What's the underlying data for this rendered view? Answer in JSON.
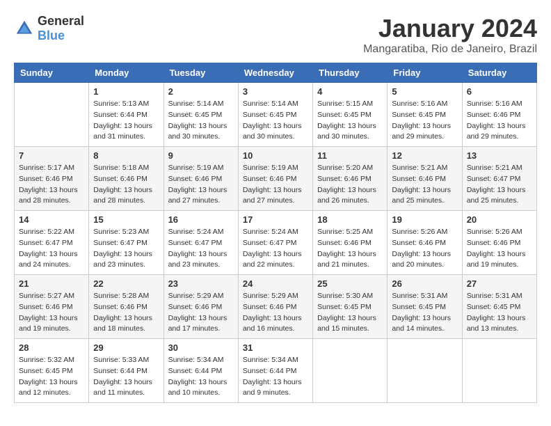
{
  "header": {
    "logo_general": "General",
    "logo_blue": "Blue",
    "month_title": "January 2024",
    "location": "Mangaratiba, Rio de Janeiro, Brazil"
  },
  "weekdays": [
    "Sunday",
    "Monday",
    "Tuesday",
    "Wednesday",
    "Thursday",
    "Friday",
    "Saturday"
  ],
  "weeks": [
    [
      {
        "day": "",
        "sunrise": "",
        "sunset": "",
        "daylight": ""
      },
      {
        "day": "1",
        "sunrise": "Sunrise: 5:13 AM",
        "sunset": "Sunset: 6:44 PM",
        "daylight": "Daylight: 13 hours and 31 minutes."
      },
      {
        "day": "2",
        "sunrise": "Sunrise: 5:14 AM",
        "sunset": "Sunset: 6:45 PM",
        "daylight": "Daylight: 13 hours and 30 minutes."
      },
      {
        "day": "3",
        "sunrise": "Sunrise: 5:14 AM",
        "sunset": "Sunset: 6:45 PM",
        "daylight": "Daylight: 13 hours and 30 minutes."
      },
      {
        "day": "4",
        "sunrise": "Sunrise: 5:15 AM",
        "sunset": "Sunset: 6:45 PM",
        "daylight": "Daylight: 13 hours and 30 minutes."
      },
      {
        "day": "5",
        "sunrise": "Sunrise: 5:16 AM",
        "sunset": "Sunset: 6:45 PM",
        "daylight": "Daylight: 13 hours and 29 minutes."
      },
      {
        "day": "6",
        "sunrise": "Sunrise: 5:16 AM",
        "sunset": "Sunset: 6:46 PM",
        "daylight": "Daylight: 13 hours and 29 minutes."
      }
    ],
    [
      {
        "day": "7",
        "sunrise": "Sunrise: 5:17 AM",
        "sunset": "Sunset: 6:46 PM",
        "daylight": "Daylight: 13 hours and 28 minutes."
      },
      {
        "day": "8",
        "sunrise": "Sunrise: 5:18 AM",
        "sunset": "Sunset: 6:46 PM",
        "daylight": "Daylight: 13 hours and 28 minutes."
      },
      {
        "day": "9",
        "sunrise": "Sunrise: 5:19 AM",
        "sunset": "Sunset: 6:46 PM",
        "daylight": "Daylight: 13 hours and 27 minutes."
      },
      {
        "day": "10",
        "sunrise": "Sunrise: 5:19 AM",
        "sunset": "Sunset: 6:46 PM",
        "daylight": "Daylight: 13 hours and 27 minutes."
      },
      {
        "day": "11",
        "sunrise": "Sunrise: 5:20 AM",
        "sunset": "Sunset: 6:46 PM",
        "daylight": "Daylight: 13 hours and 26 minutes."
      },
      {
        "day": "12",
        "sunrise": "Sunrise: 5:21 AM",
        "sunset": "Sunset: 6:46 PM",
        "daylight": "Daylight: 13 hours and 25 minutes."
      },
      {
        "day": "13",
        "sunrise": "Sunrise: 5:21 AM",
        "sunset": "Sunset: 6:47 PM",
        "daylight": "Daylight: 13 hours and 25 minutes."
      }
    ],
    [
      {
        "day": "14",
        "sunrise": "Sunrise: 5:22 AM",
        "sunset": "Sunset: 6:47 PM",
        "daylight": "Daylight: 13 hours and 24 minutes."
      },
      {
        "day": "15",
        "sunrise": "Sunrise: 5:23 AM",
        "sunset": "Sunset: 6:47 PM",
        "daylight": "Daylight: 13 hours and 23 minutes."
      },
      {
        "day": "16",
        "sunrise": "Sunrise: 5:24 AM",
        "sunset": "Sunset: 6:47 PM",
        "daylight": "Daylight: 13 hours and 23 minutes."
      },
      {
        "day": "17",
        "sunrise": "Sunrise: 5:24 AM",
        "sunset": "Sunset: 6:47 PM",
        "daylight": "Daylight: 13 hours and 22 minutes."
      },
      {
        "day": "18",
        "sunrise": "Sunrise: 5:25 AM",
        "sunset": "Sunset: 6:46 PM",
        "daylight": "Daylight: 13 hours and 21 minutes."
      },
      {
        "day": "19",
        "sunrise": "Sunrise: 5:26 AM",
        "sunset": "Sunset: 6:46 PM",
        "daylight": "Daylight: 13 hours and 20 minutes."
      },
      {
        "day": "20",
        "sunrise": "Sunrise: 5:26 AM",
        "sunset": "Sunset: 6:46 PM",
        "daylight": "Daylight: 13 hours and 19 minutes."
      }
    ],
    [
      {
        "day": "21",
        "sunrise": "Sunrise: 5:27 AM",
        "sunset": "Sunset: 6:46 PM",
        "daylight": "Daylight: 13 hours and 19 minutes."
      },
      {
        "day": "22",
        "sunrise": "Sunrise: 5:28 AM",
        "sunset": "Sunset: 6:46 PM",
        "daylight": "Daylight: 13 hours and 18 minutes."
      },
      {
        "day": "23",
        "sunrise": "Sunrise: 5:29 AM",
        "sunset": "Sunset: 6:46 PM",
        "daylight": "Daylight: 13 hours and 17 minutes."
      },
      {
        "day": "24",
        "sunrise": "Sunrise: 5:29 AM",
        "sunset": "Sunset: 6:46 PM",
        "daylight": "Daylight: 13 hours and 16 minutes."
      },
      {
        "day": "25",
        "sunrise": "Sunrise: 5:30 AM",
        "sunset": "Sunset: 6:45 PM",
        "daylight": "Daylight: 13 hours and 15 minutes."
      },
      {
        "day": "26",
        "sunrise": "Sunrise: 5:31 AM",
        "sunset": "Sunset: 6:45 PM",
        "daylight": "Daylight: 13 hours and 14 minutes."
      },
      {
        "day": "27",
        "sunrise": "Sunrise: 5:31 AM",
        "sunset": "Sunset: 6:45 PM",
        "daylight": "Daylight: 13 hours and 13 minutes."
      }
    ],
    [
      {
        "day": "28",
        "sunrise": "Sunrise: 5:32 AM",
        "sunset": "Sunset: 6:45 PM",
        "daylight": "Daylight: 13 hours and 12 minutes."
      },
      {
        "day": "29",
        "sunrise": "Sunrise: 5:33 AM",
        "sunset": "Sunset: 6:44 PM",
        "daylight": "Daylight: 13 hours and 11 minutes."
      },
      {
        "day": "30",
        "sunrise": "Sunrise: 5:34 AM",
        "sunset": "Sunset: 6:44 PM",
        "daylight": "Daylight: 13 hours and 10 minutes."
      },
      {
        "day": "31",
        "sunrise": "Sunrise: 5:34 AM",
        "sunset": "Sunset: 6:44 PM",
        "daylight": "Daylight: 13 hours and 9 minutes."
      },
      {
        "day": "",
        "sunrise": "",
        "sunset": "",
        "daylight": ""
      },
      {
        "day": "",
        "sunrise": "",
        "sunset": "",
        "daylight": ""
      },
      {
        "day": "",
        "sunrise": "",
        "sunset": "",
        "daylight": ""
      }
    ]
  ]
}
